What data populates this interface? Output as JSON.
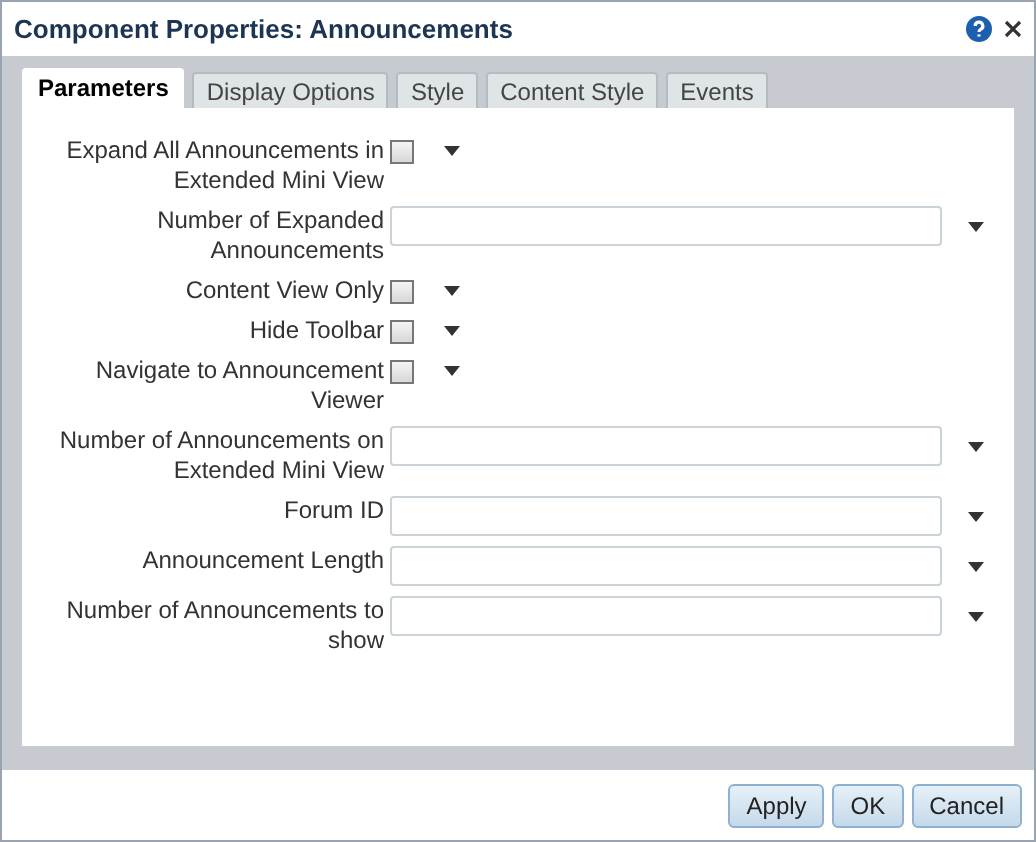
{
  "window": {
    "title": "Component Properties: Announcements"
  },
  "tabs": [
    {
      "label": "Parameters",
      "selected": true
    },
    {
      "label": "Display Options",
      "selected": false
    },
    {
      "label": "Style",
      "selected": false
    },
    {
      "label": "Content Style",
      "selected": false
    },
    {
      "label": "Events",
      "selected": false
    }
  ],
  "fields": [
    {
      "kind": "checkbox",
      "label": "Expand All Announcements in Extended Mini View",
      "checked": false
    },
    {
      "kind": "text",
      "label": "Number of Expanded Announcements"
    },
    {
      "kind": "checkbox",
      "label": "Content View Only",
      "checked": false
    },
    {
      "kind": "checkbox",
      "label": "Hide Toolbar",
      "checked": false
    },
    {
      "kind": "checkbox",
      "label": "Navigate to Announcement Viewer",
      "checked": false
    },
    {
      "kind": "text",
      "label": "Number of Announcements on Extended Mini View"
    },
    {
      "kind": "text",
      "label": "Forum ID"
    },
    {
      "kind": "text",
      "label": "Announcement Length"
    },
    {
      "kind": "text",
      "label": "Number of Announcements to show"
    }
  ],
  "buttons": [
    "Apply",
    "OK",
    "Cancel"
  ]
}
